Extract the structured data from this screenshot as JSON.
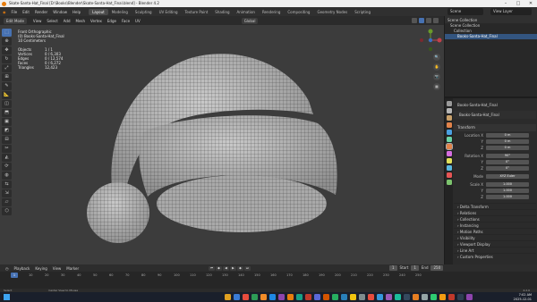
{
  "window": {
    "title": "Skate-Santa-Hat_Final [D:\\Books\\Blender\\Skate-Santa-Hat_Final.blend] - Blender 4.2"
  },
  "menu": {
    "items": [
      "File",
      "Edit",
      "Render",
      "Window",
      "Help"
    ],
    "workspaces": [
      "Layout",
      "Modeling",
      "Sculpting",
      "UV Editing",
      "Texture Paint",
      "Shading",
      "Animation",
      "Rendering",
      "Compositing",
      "Geometry Nodes",
      "Scripting"
    ],
    "active_workspace": "Layout",
    "scene": "Scene",
    "view_layer": "View Layer"
  },
  "viewport": {
    "mode": "Edit Mode",
    "menus": [
      "View",
      "Select",
      "Add",
      "Mesh",
      "Vertex",
      "Edge",
      "Face",
      "UV"
    ],
    "orientation": "Global",
    "overlay_title": "Front Orthographic",
    "overlay_object": "(0) Books-Santa-Hat_Final",
    "overlay_units": "10 Centimeters",
    "stats": [
      {
        "label": "Objects",
        "value": "1 / 1"
      },
      {
        "label": "Vertices",
        "value": "0 / 6,303"
      },
      {
        "label": "Edges",
        "value": "0 / 12,574"
      },
      {
        "label": "Faces",
        "value": "0 / 6,272"
      },
      {
        "label": "Triangles",
        "value": "12,423"
      }
    ],
    "tool_icons": [
      "select-icon",
      "cursor-icon",
      "move-icon",
      "rotate-icon",
      "scale-icon",
      "transform-icon",
      "annotate-icon",
      "measure-icon",
      "add-cube-icon",
      "extrude-icon",
      "inset-icon",
      "bevel-icon",
      "loopcut-icon",
      "knife-icon",
      "polybuild-icon",
      "spin-icon",
      "smooth-icon",
      "edge-slide-icon",
      "shrink-icon",
      "shear-icon",
      "rip-icon"
    ]
  },
  "outliner": {
    "header": "Scene Collection",
    "rows": [
      {
        "label": "Scene Collection",
        "selected": false
      },
      {
        "label": "Collection",
        "selected": false
      },
      {
        "label": "Books-Santa-Hat_Final",
        "selected": true
      }
    ]
  },
  "properties": {
    "object_name": "Books-Santa-Hat_Final",
    "data_name": "Books-Santa-Hat_Final",
    "transform_title": "Transform",
    "location": {
      "label": "Location X",
      "x": "0 m",
      "y": "0 m",
      "z": "0 m"
    },
    "rotation": {
      "label": "Rotation X",
      "x": "90°",
      "y": "0°",
      "z": "0°"
    },
    "mode_label": "Mode",
    "mode_value": "XYZ Euler",
    "scale": {
      "label": "Scale X",
      "x": "1.000",
      "y": "1.000",
      "z": "1.000"
    },
    "sections": [
      "Delta Transform",
      "Relations",
      "Collections",
      "Instancing",
      "Motion Paths",
      "Visibility",
      "Viewport Display",
      "Line Art",
      "Custom Properties"
    ],
    "tab_colors": [
      "#9a9a9a",
      "#b5b5b5",
      "#c9a06a",
      "#e2834a",
      "#4aa0e2",
      "#6bd3a5",
      "#d15f5f",
      "#d66ee0",
      "#e0e05a",
      "#5ab8e0",
      "#e65555",
      "#7cc36d"
    ]
  },
  "timeline": {
    "menus": [
      "Playback",
      "Keying",
      "View",
      "Marker"
    ],
    "current_frame": "1",
    "start_label": "Start",
    "start": "1",
    "end_label": "End",
    "end": "250",
    "ruler": [
      "1",
      "10",
      "20",
      "30",
      "40",
      "50",
      "60",
      "70",
      "80",
      "90",
      "100",
      "110",
      "120",
      "130",
      "140",
      "150",
      "160",
      "170",
      "180",
      "190",
      "200",
      "210",
      "220",
      "230",
      "240",
      "250"
    ]
  },
  "status": {
    "hint": "Select",
    "hint2": "Center View to Mouse",
    "version": "4.2.0"
  },
  "taskbar": {
    "time": "7:02 AM",
    "date": "2025-12-01",
    "app_colors": [
      "#e0a020",
      "#3a7bd5",
      "#e84c3d",
      "#2d9c56",
      "#f28c28",
      "#1e88e5",
      "#8e44ad",
      "#e87d0d",
      "#16a085",
      "#c0392b",
      "#5a67d8",
      "#d35400",
      "#27ae60",
      "#2980b9",
      "#f1c40f",
      "#7f8c8d",
      "#e74c3c",
      "#3498db",
      "#9b59b6",
      "#1abc9c",
      "#34495e",
      "#e67e22",
      "#95a5a6",
      "#2ecc71",
      "#f39c12",
      "#c0392b",
      "#2c3e50",
      "#8e44ad"
    ]
  }
}
